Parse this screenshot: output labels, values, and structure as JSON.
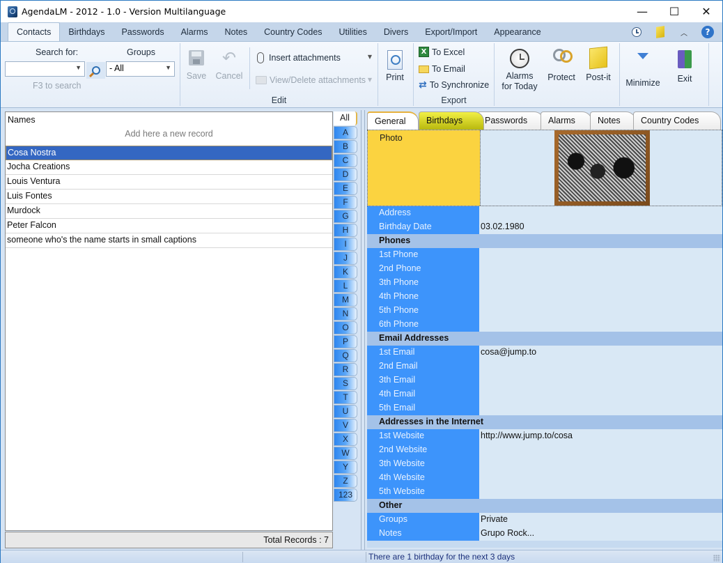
{
  "window": {
    "title": "AgendaLM - 2012 - 1.0 - Version Multilanguage",
    "controls": {
      "minimize": "—",
      "maximize": "☐",
      "close": "✕"
    }
  },
  "menu": {
    "tabs": [
      "Contacts",
      "Birthdays",
      "Passwords",
      "Alarms",
      "Notes",
      "Country Codes",
      "Utilities",
      "Divers",
      "Export/Import",
      "Appearance"
    ],
    "active": "Contacts",
    "right_icons": [
      "clock-icon",
      "postit-icon",
      "collapse-ribbon-icon",
      "help-icon"
    ],
    "help_glyph": "?",
    "collapse_glyph": "︿"
  },
  "ribbon": {
    "search": {
      "label": "Search for:",
      "value": "",
      "hint": "F3 to search"
    },
    "groups_filter": {
      "label": "Groups",
      "value": "- All"
    },
    "edit": {
      "save": "Save",
      "cancel": "Cancel",
      "insert_attachments": "Insert attachments",
      "view_delete_attachments": "View/Delete attachments",
      "caption": "Edit"
    },
    "print": "Print",
    "export": {
      "to_excel": "To Excel",
      "to_email": "To Email",
      "to_synchronize": "To Synchronize",
      "caption": "Export",
      "excel_glyph": "X",
      "sync_glyph": "⇄"
    },
    "tools": {
      "alarms_for_today_line1": "Alarms",
      "alarms_for_today_line2": "for Today",
      "protect": "Protect",
      "postit": "Post-it",
      "minimize": "Minimize",
      "exit": "Exit"
    }
  },
  "names_pane": {
    "header": "Names",
    "add_hint": "Add here a new record",
    "records": [
      "Cosa Nostra",
      "Jocha Creations",
      "Louis Ventura",
      "Luis Fontes",
      "Murdock",
      "Peter Falcon",
      "someone who's the name starts in small captions"
    ],
    "selected_index": 0,
    "total_label": "Total Records : 7"
  },
  "alphabet": {
    "all": "All",
    "letters": [
      "A",
      "B",
      "C",
      "D",
      "E",
      "F",
      "G",
      "H",
      "I",
      "J",
      "K",
      "L",
      "M",
      "N",
      "O",
      "P",
      "Q",
      "R",
      "S",
      "T",
      "U",
      "V",
      "X",
      "W",
      "Y",
      "Z",
      "123"
    ]
  },
  "detail": {
    "tabs": [
      "General",
      "Birthdays",
      "Passwords",
      "Alarms",
      "Notes",
      "Country Codes"
    ],
    "active_tab": "General",
    "photo_label": "Photo",
    "rows_top": [
      {
        "key": "Address",
        "value": ""
      },
      {
        "key": "Birthday Date",
        "value": "03.02.1980"
      }
    ],
    "sections": [
      {
        "title": "Phones",
        "rows": [
          {
            "key": "1st Phone",
            "value": ""
          },
          {
            "key": "2nd Phone",
            "value": ""
          },
          {
            "key": "3th Phone",
            "value": ""
          },
          {
            "key": "4th Phone",
            "value": ""
          },
          {
            "key": "5th Phone",
            "value": ""
          },
          {
            "key": "6th Phone",
            "value": ""
          }
        ]
      },
      {
        "title": "Email Addresses",
        "rows": [
          {
            "key": "1st Email",
            "value": "cosa@jump.to"
          },
          {
            "key": "2nd Email",
            "value": ""
          },
          {
            "key": "3th Email",
            "value": ""
          },
          {
            "key": "4th Email",
            "value": ""
          },
          {
            "key": "5th Email",
            "value": ""
          }
        ]
      },
      {
        "title": "Addresses in the Internet",
        "rows": [
          {
            "key": "1st Website",
            "value": "http://www.jump.to/cosa"
          },
          {
            "key": "2nd Website",
            "value": ""
          },
          {
            "key": "3th Website",
            "value": ""
          },
          {
            "key": "4th Website",
            "value": ""
          },
          {
            "key": "5th Website",
            "value": ""
          }
        ]
      },
      {
        "title": "Other",
        "rows": [
          {
            "key": "Groups",
            "value": "Private"
          },
          {
            "key": "Notes",
            "value": "Grupo Rock..."
          }
        ]
      }
    ]
  },
  "statusbar": {
    "message": "There are 1 birthday for the next 3 days"
  },
  "colors": {
    "selected_row": "#3467c2",
    "field_label_bg": "#3d94fb",
    "section_bg": "#a4c2e8",
    "photo_label_bg": "#fbd340",
    "value_bg": "#d9e8f5"
  }
}
